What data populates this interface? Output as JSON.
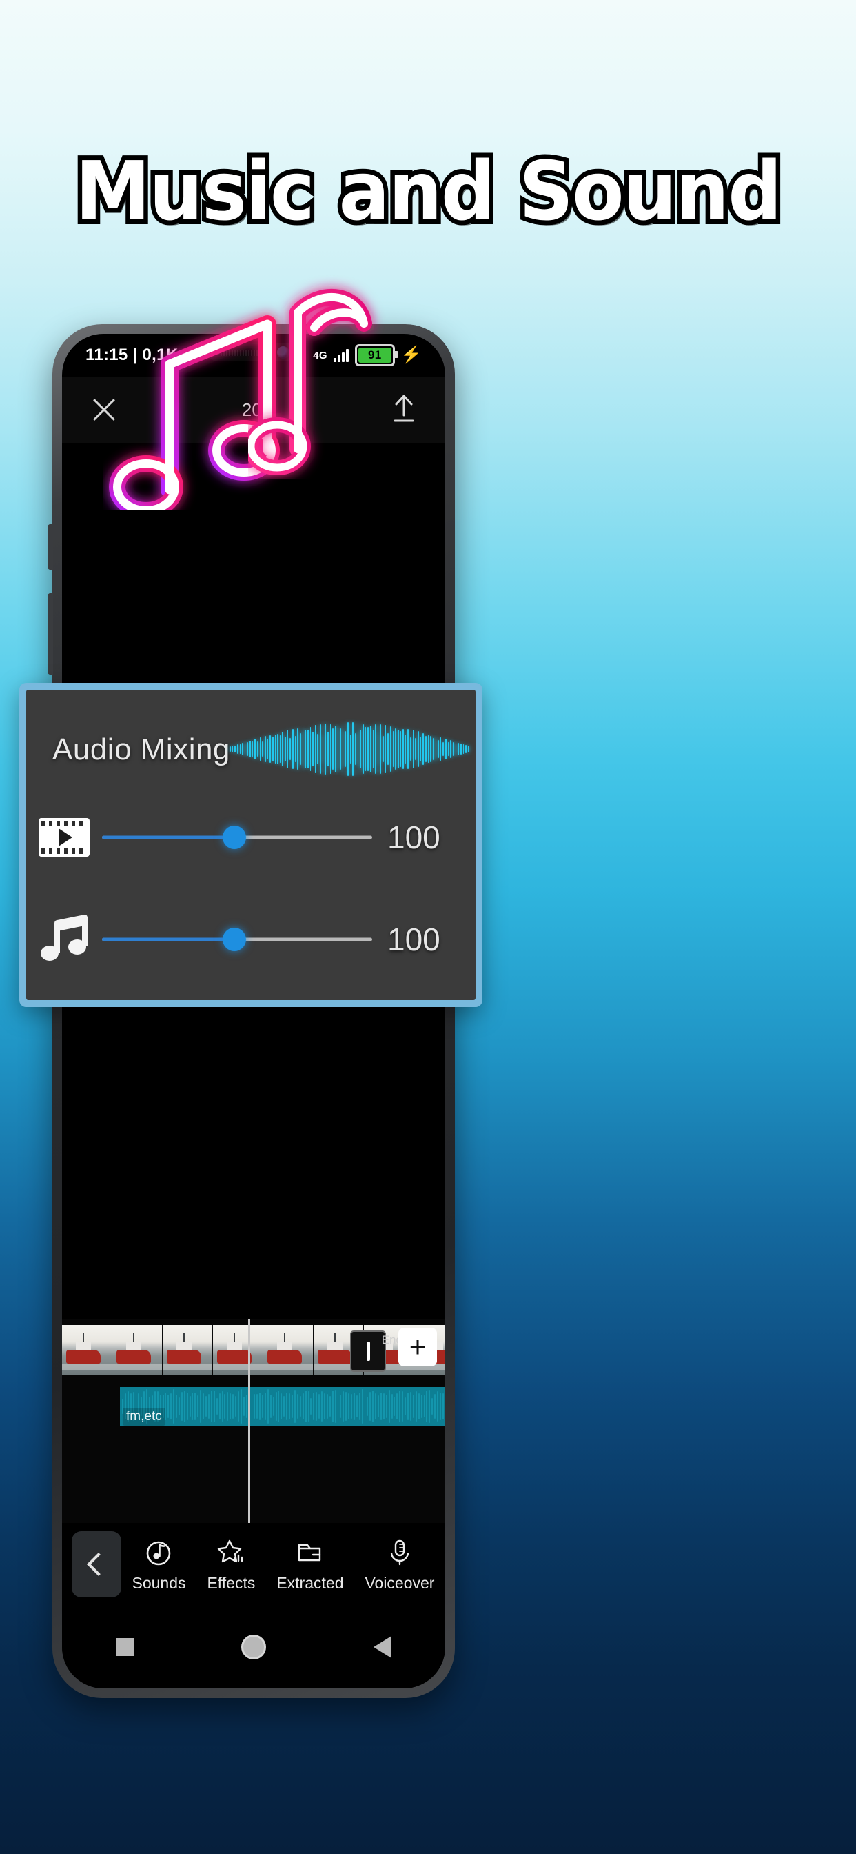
{
  "poster": {
    "title": "Music and Sound",
    "background_top_color": "#f2fbfb",
    "background_mid_color": "#2fb5de",
    "background_bottom_color": "#061f3c",
    "note_icon_left": "music-note-beamed-icon",
    "note_icon_right": "music-note-eighth-icon"
  },
  "status_bar": {
    "time_and_data": "11:15 | 0,1K",
    "network": "4G",
    "battery_percent": "91",
    "charging_icon": "lightning-bolt-icon",
    "signal_icon": "signal-bars-icon"
  },
  "app_toolbar": {
    "close_icon": "close-x-icon",
    "timecode": "20:",
    "export_icon": "upload-arrow-icon"
  },
  "audio_mixing": {
    "title": "Audio Mixing",
    "waveform_color": "#24c8ef",
    "accent_color": "#1e8fe0",
    "card_border_color": "#78b9dd",
    "rows": [
      {
        "icon": "video-film-icon",
        "value": "100",
        "percent": 49
      },
      {
        "icon": "music-note-icon",
        "value": "100",
        "percent": 49
      }
    ]
  },
  "timeline": {
    "clip_label": "fm,etc",
    "end_label": "End",
    "add_button_label": "+",
    "waveform_color": "#1496ad"
  },
  "bottom_tabs": {
    "back_icon": "chevron-left-icon",
    "items": [
      {
        "label": "Sounds",
        "icon": "disc-note-icon"
      },
      {
        "label": "Effects",
        "icon": "star-sound-icon"
      },
      {
        "label": "Extracted",
        "icon": "folder-icon"
      },
      {
        "label": "Voiceover",
        "icon": "microphone-icon"
      }
    ]
  },
  "android_nav": {
    "recents_icon": "square-icon",
    "home_icon": "circle-icon",
    "back_icon": "triangle-back-icon"
  }
}
